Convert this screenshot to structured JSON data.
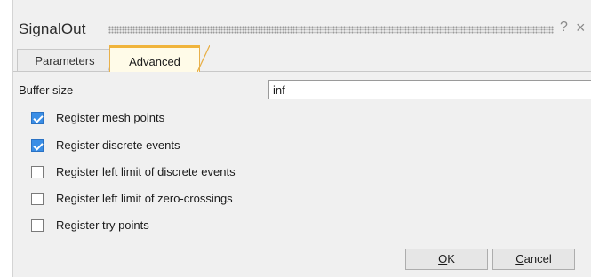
{
  "dialog": {
    "title": "SignalOut",
    "help_glyph": "?",
    "close_glyph": "×"
  },
  "tabs": [
    {
      "label": "Parameters",
      "active": false
    },
    {
      "label": "Advanced",
      "active": true
    }
  ],
  "buffer": {
    "label": "Buffer size",
    "value": "inf"
  },
  "checkboxes": [
    {
      "label": "Register mesh points",
      "checked": true
    },
    {
      "label": "Register discrete events",
      "checked": true
    },
    {
      "label": "Register left limit of discrete events",
      "checked": false
    },
    {
      "label": "Register left limit of zero-crossings",
      "checked": false
    },
    {
      "label": "Register try points",
      "checked": false
    }
  ],
  "buttons": {
    "ok": {
      "mnemonic": "O",
      "rest": "K"
    },
    "cancel": {
      "mnemonic": "C",
      "rest": "ancel"
    }
  },
  "colors": {
    "active_tab_accent": "#f0b43c",
    "checkbox_checked": "#3a8ee6"
  }
}
